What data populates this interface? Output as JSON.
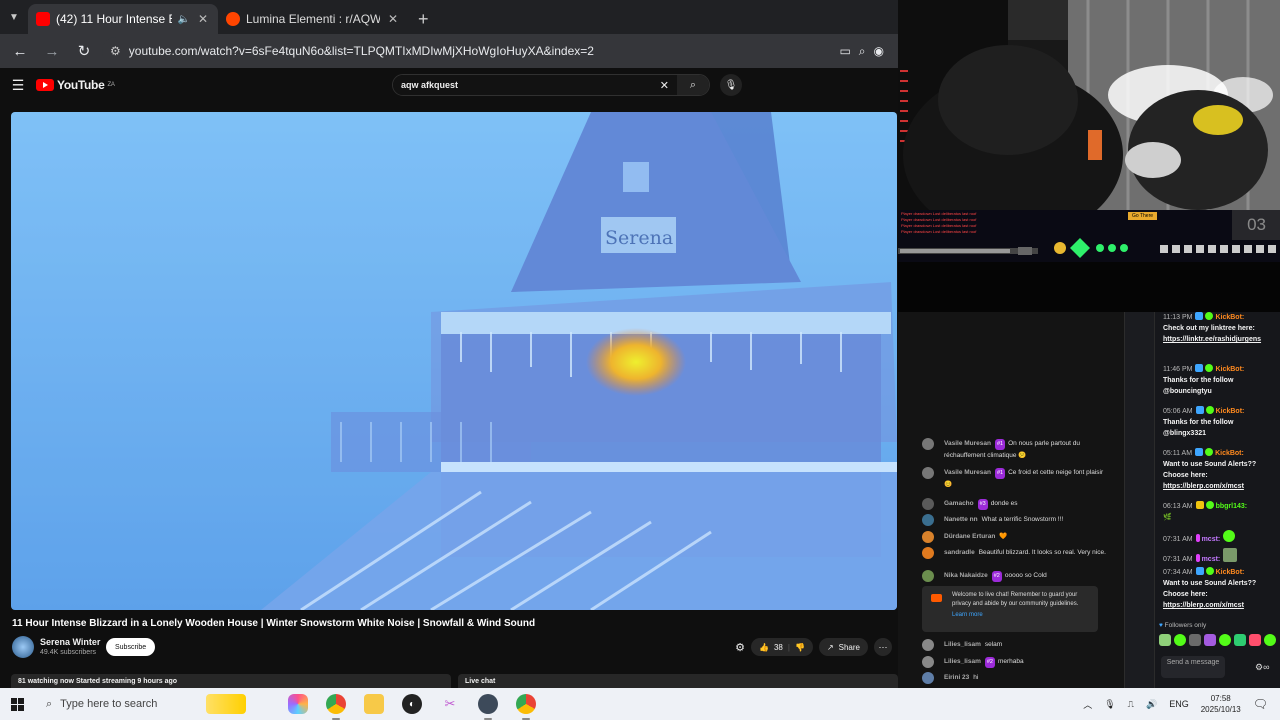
{
  "browser": {
    "tabs": [
      {
        "title": "(42) 11 Hour Intense Blizzar",
        "active": true,
        "muted": true
      },
      {
        "title": "Lumina Elementi : r/AQW",
        "active": false
      }
    ],
    "url": "youtube.com/watch?v=6sFe4tquN6o&list=TLPQMTIxMDIwMjXHoWgIoHuyXA&index=2"
  },
  "youtube": {
    "logo_text": "YouTube",
    "logo_sup": "ZA",
    "search_query": "aqw afkquest",
    "video_title": "11 Hour Intense Blizzard in a Lonely Wooden House | Winter Snowstorm White Noise | Snowfall & Wind Sound",
    "channel_name": "Serena Winter",
    "subscribers": "49.4K subscribers",
    "subscribe_label": "Subscribe",
    "likes": "38",
    "share_label": "Share",
    "watching": "81 watching now  Started streaming 9 hours ago",
    "live_chat_label": "Live chat",
    "sign_text": "Serena"
  },
  "stream": {
    "countdown": "03",
    "go_there": "Go There",
    "game_lines": [
      "Player drawdown Lost deliberatus last roof",
      "Player drawdown Lost deliberatus last roof",
      "Player drawdown Lost deliberatus last roof",
      "Player drawdown Lost deliberatus last roof"
    ]
  },
  "yt_chat": {
    "messages": [
      {
        "author": "Vasile Muresan",
        "badge": "#1",
        "text": "On nous parle partout du réchauffement climatique 😕",
        "avatar_color": "#777777"
      },
      {
        "author": "Vasile Muresan",
        "badge": "#1",
        "text": "Ce froid et cette neige font plaisir 😊",
        "avatar_color": "#777777"
      },
      {
        "author": "Gamacho",
        "badge": "#3",
        "text": "donde es",
        "avatar_color": "#5a5a5a"
      },
      {
        "author": "Nanette nn",
        "badge": "",
        "text": "What a terrific Snowstorm !!!",
        "avatar_color": "#3a6e8f"
      },
      {
        "author": "Dürdane Erturan",
        "badge": "",
        "text": "🧡",
        "avatar_color": "#d9822b"
      },
      {
        "author": "sandradle",
        "badge": "",
        "text": "Beautiful blizzard. It looks so real. Very nice.",
        "avatar_color": "#e07a1f"
      },
      {
        "author": "Nika Nakaidze",
        "badge": "#2",
        "text": "ooooo so Cold",
        "avatar_color": "#6b8e4e"
      }
    ],
    "welcome_text": "Welcome to live chat! Remember to guard your privacy and abide by our community guidelines.",
    "learn_more": "Learn more",
    "bottom_messages": [
      {
        "author": "Lilies_lisam",
        "badge": "",
        "text": "selam",
        "avatar_color": "#888888"
      },
      {
        "author": "Lilies_lisam",
        "badge": "#2",
        "text": "merhaba",
        "avatar_color": "#888888"
      },
      {
        "author": "Eirini 23",
        "badge": "",
        "text": "hi",
        "avatar_color": "#5f7ea8"
      }
    ]
  },
  "kick_chat": {
    "messages": [
      {
        "time": "11:13 PM",
        "user": "KickBot:",
        "color": "orange",
        "text": "Check out my linktree here: ",
        "link": "https://linktr.ee/rashidjurgens"
      },
      {
        "time": "11:46 PM",
        "user": "KickBot:",
        "color": "orange",
        "text": "Thanks for the follow @bouncingtyu",
        "link": ""
      },
      {
        "time": "05:06 AM",
        "user": "KickBot:",
        "color": "orange",
        "text": "Thanks for the follow @blingx3321",
        "link": ""
      },
      {
        "time": "05:11 AM",
        "user": "KickBot:",
        "color": "orange",
        "text": "Want to use Sound Alerts?? Choose here: ",
        "link": "https://blerp.com/x/mcst"
      },
      {
        "time": "06:13 AM",
        "user": "bbgrl143:",
        "color": "green",
        "text": "🌿",
        "link": ""
      },
      {
        "time": "07:31 AM",
        "user": "mcst:",
        "color": "purple",
        "text": "",
        "link": ""
      },
      {
        "time": "07:31 AM",
        "user": "mcst:",
        "color": "purple",
        "text": "",
        "link": ""
      },
      {
        "time": "07:34 AM",
        "user": "KickBot:",
        "color": "orange",
        "text": "Want to use Sound Alerts?? Choose here: ",
        "link": "https://blerp.com/x/mcst"
      }
    ],
    "followers_only": "Followers only",
    "send_placeholder": "Send a message"
  },
  "taskbar": {
    "search_placeholder": "Type here to search",
    "language": "ENG",
    "time": "07:58",
    "date": "2025/10/13"
  },
  "colors": {
    "yt_red": "#ff0000",
    "kick_green": "#53fc18",
    "kick_orange": "#ff8a1f",
    "video_tint": "#5aa8f0"
  }
}
